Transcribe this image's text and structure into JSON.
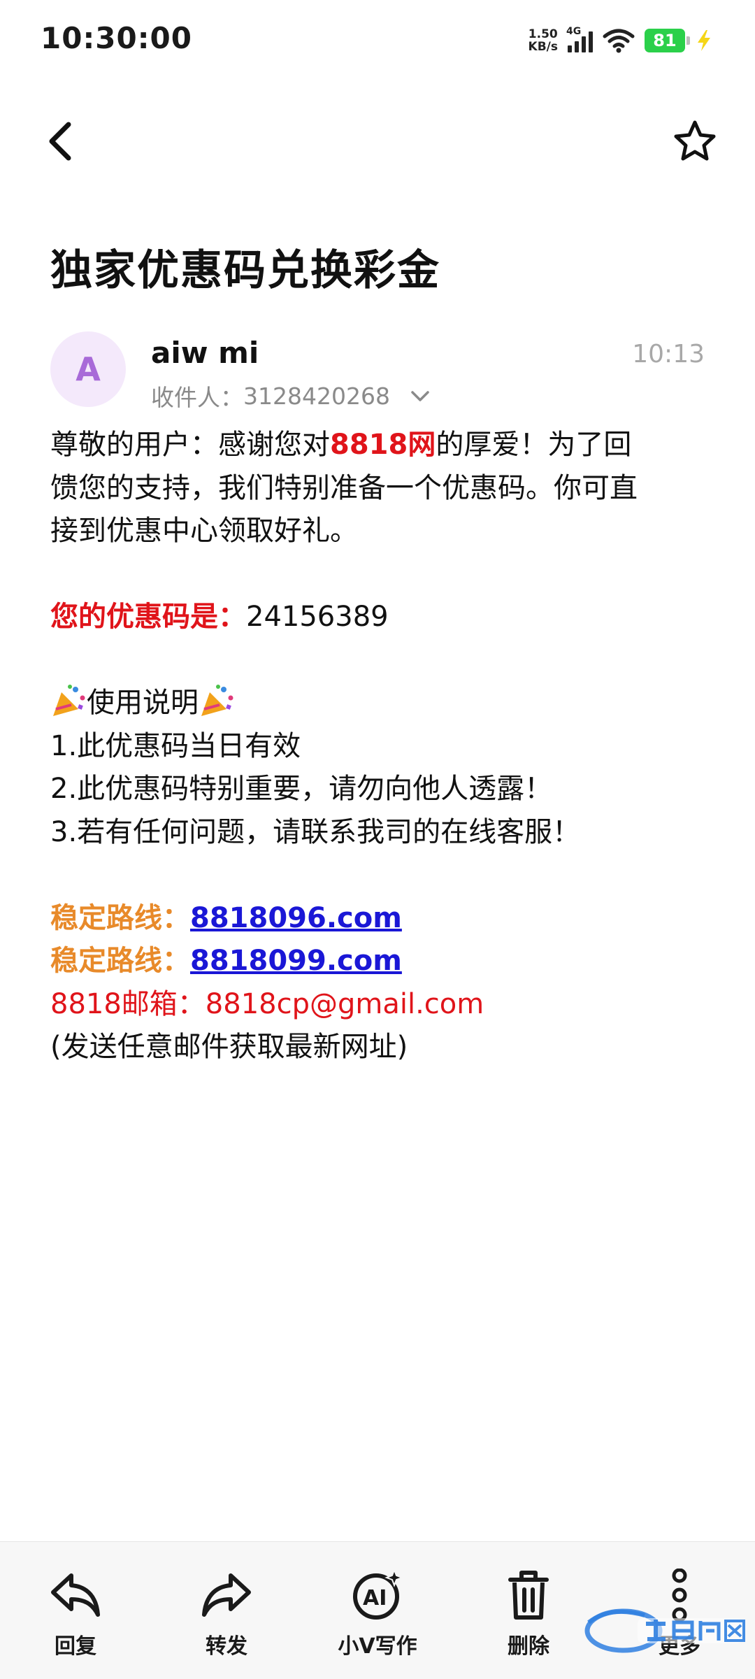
{
  "status_bar": {
    "time": "10:30:00",
    "net_speed_value": "1.50",
    "net_speed_unit": "KB/s",
    "network_type": "4G",
    "battery": "81"
  },
  "email": {
    "subject": "独家优惠码兑换彩金",
    "sender": {
      "avatar_letter": "A",
      "name": "aiw mi",
      "time": "10:13",
      "recipient_label": "收件人：",
      "recipient": "3128420268"
    },
    "body": {
      "p1_a": "尊敬的用户：感谢您对",
      "p1_brand": "8818网",
      "p1_b": "的厚爱！为了回",
      "p1_line2": "馈您的支持，我们特别准备一个优惠码。你可直",
      "p1_line3": "接到优惠中心领取好礼。",
      "code_label": "您的优惠码是：",
      "code_value": "24156389",
      "usage_title": "使用说明",
      "rule1": "1.此优惠码当日有效",
      "rule2": "2.此优惠码特别重要，请勿向他人透露！",
      "rule3": "3.若有任何问题，请联系我司的在线客服！",
      "route_label_1": "稳定路线：",
      "route_link_1": "8818096.com",
      "route_label_2": "稳定路线：",
      "route_link_2": "8818099.com",
      "mailbox": "8818邮箱：8818cp@gmail.com",
      "mailbox_note": " (发送任意邮件获取最新网址)"
    }
  },
  "toolbar": {
    "reply": "回复",
    "forward": "转发",
    "ai_write": "小V写作",
    "delete": "删除",
    "more": "更多"
  },
  "colors": {
    "red": "#e0141a",
    "orange": "#e88a2a",
    "link": "#1a17d6",
    "avatar_bg": "#f4e9fb",
    "avatar_fg": "#a86ad8",
    "battery": "#2bd04a"
  }
}
